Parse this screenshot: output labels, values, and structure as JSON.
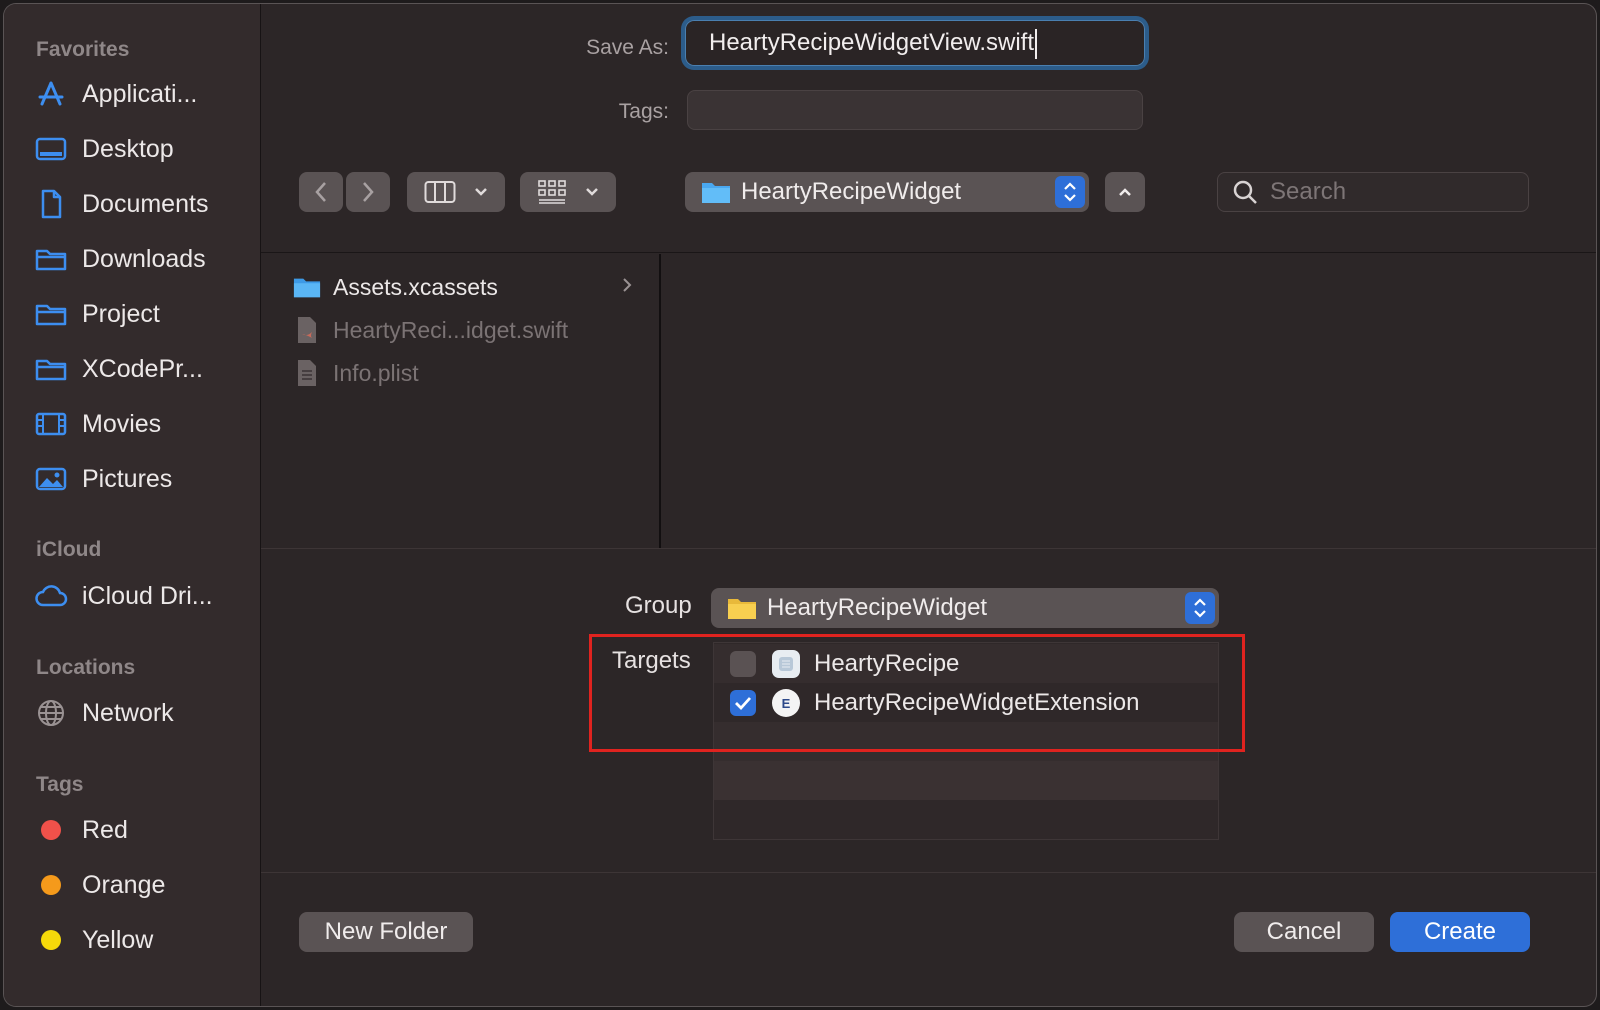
{
  "sidebar": {
    "favorites_title": "Favorites",
    "favorites": [
      {
        "label": "Applicati...",
        "icon": "applications-icon"
      },
      {
        "label": "Desktop",
        "icon": "desktop-icon"
      },
      {
        "label": "Documents",
        "icon": "document-icon"
      },
      {
        "label": "Downloads",
        "icon": "folder-icon"
      },
      {
        "label": "Project",
        "icon": "folder-icon"
      },
      {
        "label": "XCodePr...",
        "icon": "folder-icon"
      },
      {
        "label": "Movies",
        "icon": "movies-icon"
      },
      {
        "label": "Pictures",
        "icon": "pictures-icon"
      }
    ],
    "icloud_title": "iCloud",
    "icloud": [
      {
        "label": "iCloud Dri...",
        "icon": "cloud-icon"
      }
    ],
    "locations_title": "Locations",
    "locations": [
      {
        "label": "Network",
        "icon": "globe-icon"
      }
    ],
    "tags_title": "Tags",
    "tags": [
      {
        "label": "Red",
        "color": "#f0514a"
      },
      {
        "label": "Orange",
        "color": "#f59a1b"
      },
      {
        "label": "Yellow",
        "color": "#f5d90a"
      }
    ]
  },
  "save_as": {
    "label": "Save As:",
    "value": "HeartyRecipeWidgetView.swift"
  },
  "tags_field": {
    "label": "Tags:",
    "value": ""
  },
  "toolbar": {
    "location": "HeartyRecipeWidget",
    "search_placeholder": "Search"
  },
  "browser": {
    "files": [
      {
        "name": "Assets.xcassets",
        "type": "folder",
        "enabled": true
      },
      {
        "name": "HeartyReci...idget.swift",
        "type": "swift",
        "enabled": false
      },
      {
        "name": "Info.plist",
        "type": "plist",
        "enabled": false
      }
    ]
  },
  "options": {
    "group_label": "Group",
    "group_value": "HeartyRecipeWidget",
    "targets_label": "Targets",
    "targets": [
      {
        "name": "HeartyRecipe",
        "checked": false
      },
      {
        "name": "HeartyRecipeWidgetExtension",
        "checked": true
      }
    ]
  },
  "buttons": {
    "new_folder": "New Folder",
    "cancel": "Cancel",
    "create": "Create"
  },
  "colors": {
    "accent": "#2e6fd8",
    "highlight_box": "#e0231f"
  }
}
